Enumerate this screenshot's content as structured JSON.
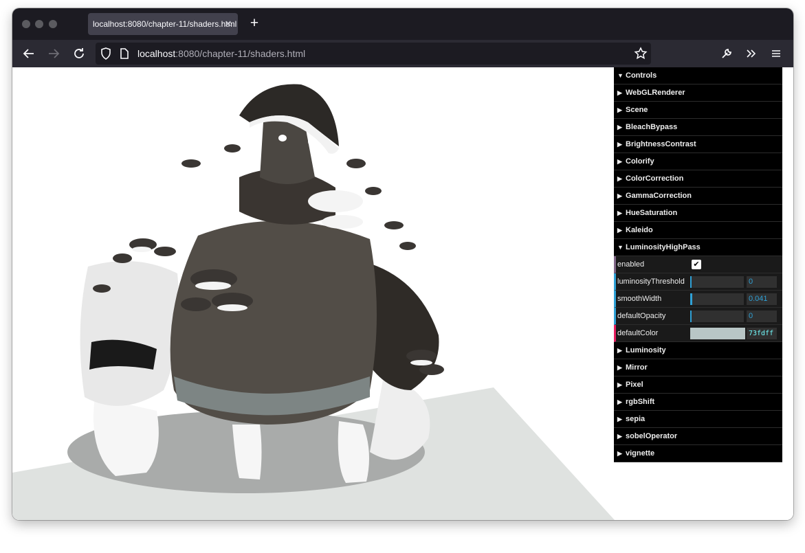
{
  "tab": {
    "title": "localhost:8080/chapter-11/shaders.html",
    "close_icon": "close-icon"
  },
  "url": {
    "host": "localhost",
    "rest": ":8080/chapter-11/shaders.html"
  },
  "colors": {
    "accent_number": "#2fa1d6",
    "accent_bool": "#806787",
    "accent_color": "#e61d5f",
    "default_color_hex": "#73fdff"
  },
  "gui": {
    "root_label": "Controls",
    "folders_before": [
      "WebGLRenderer",
      "Scene",
      "BleachBypass",
      "BrightnessContrast",
      "Colorify",
      "ColorCorrection",
      "GammaCorrection",
      "HueSaturation",
      "Kaleido"
    ],
    "open_folder": "LuminosityHighPass",
    "controls": {
      "enabled": {
        "label": "enabled",
        "checked": true
      },
      "luminosityThreshold": {
        "label": "luminosityThreshold",
        "value": "0",
        "fraction": 0.0
      },
      "smoothWidth": {
        "label": "smoothWidth",
        "value": "0.041",
        "fraction": 0.041
      },
      "defaultOpacity": {
        "label": "defaultOpacity",
        "value": "0",
        "fraction": 0.0
      },
      "defaultColor": {
        "label": "defaultColor",
        "value": "73fdff"
      }
    },
    "folders_after": [
      "Luminosity",
      "Mirror",
      "Pixel",
      "rgbShift",
      "sepia",
      "sobelOperator",
      "vignette"
    ]
  }
}
